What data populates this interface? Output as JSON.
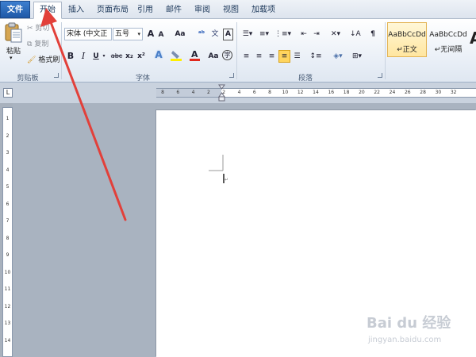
{
  "tabs": {
    "file": "文件",
    "home": "开始",
    "insert": "插入",
    "page_layout": "页面布局",
    "references": "引用",
    "mailings": "邮件",
    "review": "审阅",
    "view": "视图",
    "addins": "加载项"
  },
  "clipboard": {
    "paste": "粘贴",
    "cut": "剪切",
    "copy": "复制",
    "format_painter": "格式刷",
    "group": "剪贴板"
  },
  "font": {
    "name": "宋体 (中文正",
    "size": "五号",
    "group": "字体",
    "grow": "A",
    "shrink": "A",
    "change_case": "Aa",
    "bold": "B",
    "italic": "I",
    "underline": "U",
    "strike": "abc",
    "subscript": "x₂",
    "superscript": "x²",
    "highlight_color": "#ffef00",
    "font_color": "#e0281c"
  },
  "paragraph": {
    "group": "段落"
  },
  "styles": {
    "normal_sample": "AaBbCcDd",
    "normal": "正文",
    "nospacing_sample": "AaBbCcDd",
    "nospacing": "无间隔",
    "heading_sample": "A"
  },
  "ruler": {
    "h_numbers": [
      "8",
      "6",
      "4",
      "2",
      "2",
      "4",
      "6",
      "8",
      "10",
      "12",
      "14",
      "16",
      "18",
      "20",
      "22",
      "24",
      "26",
      "28",
      "30",
      "32"
    ],
    "v_numbers": [
      "1",
      "2",
      "3",
      "4",
      "5",
      "6",
      "7",
      "8",
      "9",
      "10",
      "11",
      "12",
      "13",
      "14"
    ],
    "tab_selector": "L"
  },
  "watermark": {
    "brand": "Bai du 经验",
    "url": "jingyan.baidu.com"
  },
  "annotation": {
    "color": "#e2403a"
  }
}
